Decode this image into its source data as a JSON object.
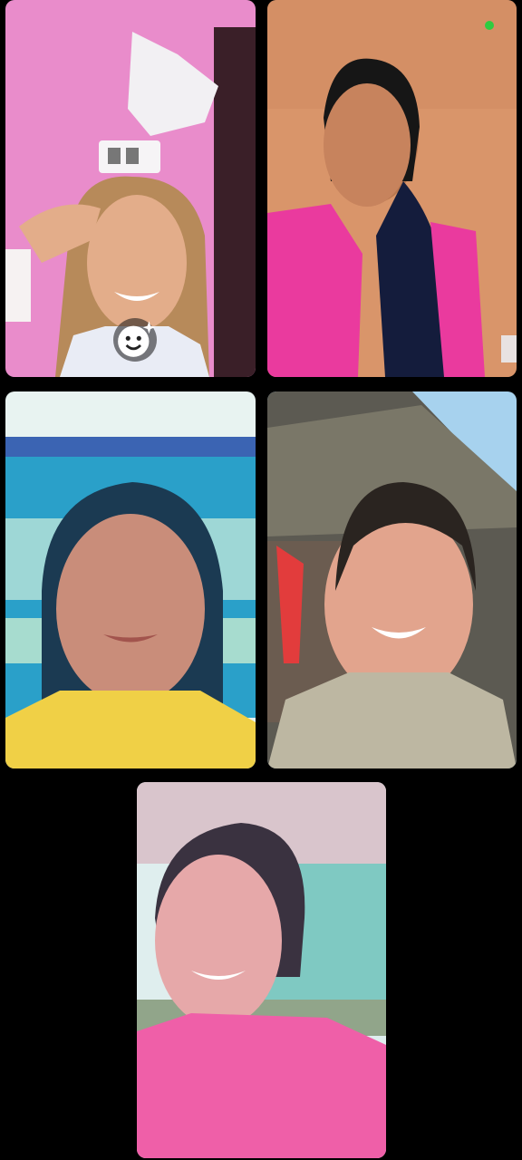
{
  "call": {
    "participant_count": 5,
    "colors": {
      "background": "#000000",
      "active_indicator": "#2ecc40",
      "tile1_wall": "#e98ccb",
      "tile2_wall": "#d9956a",
      "tile3_building": "#2aa0c9",
      "tile4_sky": "#a7d2ee",
      "tile5_building": "#7fc9c2"
    }
  },
  "controls": {
    "effects_icon": "smiley-sparkle-icon"
  },
  "indicators": {
    "active_dot_icon": "green-dot-icon"
  }
}
